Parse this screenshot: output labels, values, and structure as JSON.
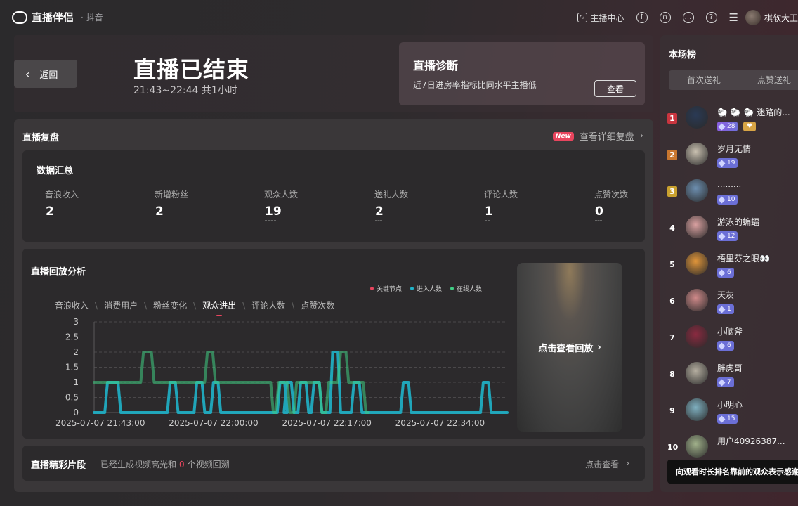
{
  "app": {
    "name": "直播伴侣",
    "sub": "· 抖音"
  },
  "topbar": {
    "center_label": "主播中心",
    "username": "棋软大王",
    "icons": [
      "chart-icon",
      "upload-icon",
      "headset-icon",
      "chat-icon",
      "help-icon",
      "menu-icon"
    ]
  },
  "header": {
    "back_label": "返回",
    "title": "直播已结束",
    "time": "21:43~22:44 共1小时"
  },
  "diagnosis": {
    "title": "直播诊断",
    "desc": "近7日进房率指标比同水平主播低",
    "button": "查看"
  },
  "review": {
    "title": "直播复盘",
    "new_badge": "New",
    "detail_link": "查看详细复盘"
  },
  "summary": {
    "title": "数据汇总",
    "metrics": [
      {
        "label": "音浪收入",
        "value": "2"
      },
      {
        "label": "新增粉丝",
        "value": "2"
      },
      {
        "label": "观众人数",
        "value": "19"
      },
      {
        "label": "送礼人数",
        "value": "2"
      },
      {
        "label": "评论人数",
        "value": "1"
      },
      {
        "label": "点赞次数",
        "value": "0"
      }
    ]
  },
  "analysis": {
    "title": "直播回放分析",
    "tabs": [
      "音浪收入",
      "消费用户",
      "粉丝变化",
      "观众进出",
      "评论人数",
      "点赞次数"
    ],
    "active_tab": 3,
    "legend": [
      {
        "name": "关键节点",
        "color": "#e8455e"
      },
      {
        "name": "进入人数",
        "color": "#1fb3c9"
      },
      {
        "name": "在线人数",
        "color": "#3fce84"
      }
    ],
    "replay_label": "点击查看回放"
  },
  "chart_data": {
    "type": "line",
    "ylim": [
      0,
      3
    ],
    "y_ticks": [
      "0",
      "0.5",
      "1",
      "1.5",
      "2",
      "2.5",
      "3"
    ],
    "x_ticks": [
      "2025-07-07 21:43:00",
      "2025-07-07 22:00:00",
      "2025-07-07 22:17:00",
      "2025-07-07 22:34:00"
    ],
    "x_minutes_range": [
      0,
      62
    ],
    "grid": "horizontal-dashed",
    "series": [
      {
        "name": "进入人数",
        "color": "#1fb3c9",
        "points": [
          [
            0,
            0
          ],
          [
            1.6,
            0
          ],
          [
            2,
            1
          ],
          [
            3.6,
            1
          ],
          [
            4,
            0
          ],
          [
            11,
            0
          ],
          [
            11.4,
            1
          ],
          [
            12.2,
            1
          ],
          [
            12.6,
            0
          ],
          [
            15,
            0
          ],
          [
            15.4,
            1
          ],
          [
            16.2,
            1
          ],
          [
            16.6,
            0
          ],
          [
            17.5,
            0
          ],
          [
            17.9,
            1
          ],
          [
            18.6,
            1
          ],
          [
            19,
            0
          ],
          [
            27.5,
            0
          ],
          [
            27.9,
            1
          ],
          [
            28.6,
            1
          ],
          [
            29,
            0
          ],
          [
            28.5,
            0
          ],
          [
            28.9,
            1
          ],
          [
            29.6,
            1
          ],
          [
            30,
            0
          ],
          [
            30.6,
            0
          ],
          [
            31,
            1
          ],
          [
            31.8,
            1
          ],
          [
            32.2,
            0
          ],
          [
            32.6,
            0
          ],
          [
            33,
            1
          ],
          [
            33.8,
            1
          ],
          [
            34.2,
            0
          ],
          [
            35.4,
            0
          ],
          [
            35.8,
            2
          ],
          [
            36.6,
            2
          ],
          [
            37,
            0
          ],
          [
            38.6,
            0
          ],
          [
            39,
            1
          ],
          [
            39.8,
            1
          ],
          [
            40.2,
            0
          ],
          [
            46,
            0
          ],
          [
            46.4,
            1
          ],
          [
            47.2,
            1
          ],
          [
            47.6,
            0
          ],
          [
            58,
            0
          ],
          [
            58.4,
            1
          ],
          [
            59.2,
            1
          ],
          [
            59.6,
            0
          ],
          [
            62,
            0
          ]
        ]
      },
      {
        "name": "在线人数",
        "color": "#3fce84",
        "points": [
          [
            0,
            1
          ],
          [
            5,
            1
          ],
          [
            7,
            1
          ],
          [
            7.4,
            2
          ],
          [
            8.6,
            2
          ],
          [
            9,
            1
          ],
          [
            15.8,
            1
          ],
          [
            16.6,
            1
          ],
          [
            17,
            2
          ],
          [
            17.8,
            2
          ],
          [
            18.2,
            1
          ],
          [
            26,
            1
          ],
          [
            26.5,
            1
          ],
          [
            26.9,
            0
          ],
          [
            27.3,
            0
          ],
          [
            27.7,
            1
          ],
          [
            29,
            1
          ],
          [
            29.4,
            0
          ],
          [
            30,
            0
          ],
          [
            30.4,
            1
          ],
          [
            33.8,
            1
          ],
          [
            34.2,
            0
          ],
          [
            34.8,
            0
          ],
          [
            35.2,
            1
          ],
          [
            36.6,
            1
          ],
          [
            37,
            2
          ],
          [
            37.8,
            2
          ],
          [
            38.2,
            1
          ],
          [
            40.4,
            1
          ],
          [
            40.8,
            0
          ],
          [
            41.2,
            0
          ]
        ]
      }
    ]
  },
  "highlights": {
    "title": "直播精彩片段",
    "desc_prefix": "已经生成视频高光和",
    "count": "0",
    "desc_suffix": "个视频回溯",
    "link": "点击查看"
  },
  "ranking": {
    "title": "本场榜",
    "tabs": [
      "首次送礼",
      "点赞送礼"
    ],
    "items": [
      {
        "rank": "1",
        "name": "🐑 🐑 🐑 迷路的...",
        "level": "28",
        "fan": "♥",
        "avatar_color": "#2a3a55"
      },
      {
        "rank": "2",
        "name": "岁月无情",
        "level": "19",
        "avatar_color": "#c9c0b0"
      },
      {
        "rank": "3",
        "name": ".........",
        "level": "10",
        "avatar_color": "#6d8fb0"
      },
      {
        "rank": "4",
        "name": "游泳的蝙蝠",
        "level": "12",
        "avatar_color": "#d9a0a0"
      },
      {
        "rank": "5",
        "name": "梧里芬之眼👀",
        "level": "6",
        "avatar_color": "#e0953a"
      },
      {
        "rank": "6",
        "name": "天灰",
        "level": "1",
        "avatar_color": "#d08a8a"
      },
      {
        "rank": "7",
        "name": "小脑斧",
        "level": "6",
        "avatar_color": "#8a2a40"
      },
      {
        "rank": "8",
        "name": "胖虎哥",
        "level": "7",
        "avatar_color": "#b5aea0"
      },
      {
        "rank": "9",
        "name": "小明心",
        "level": "15",
        "avatar_color": "#7fb0c0"
      },
      {
        "rank": "10",
        "name": "用户40926387...",
        "level": "",
        "avatar_color": "#a0b08a"
      }
    ],
    "tooltip": "向观看时长排名靠前的观众表示感谢"
  }
}
